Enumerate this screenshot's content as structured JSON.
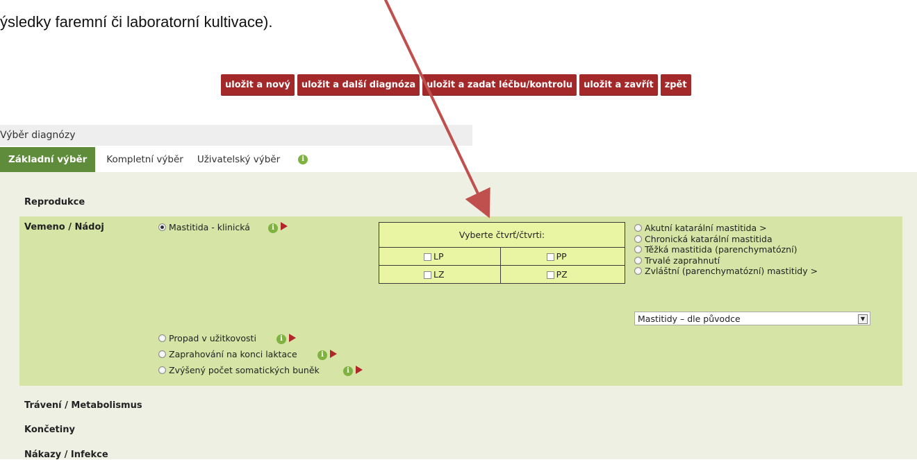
{
  "caption": "ýsledky faremní či laboratorní kultivace).",
  "toolbar": {
    "buttons": [
      "uložit a nový",
      "uložit a další diagnóza",
      "uložit a zadat léčbu/kontrolu",
      "uložit a zavřít",
      "zpět"
    ],
    "color": "#a3282a"
  },
  "section": {
    "title": "Výběr diagnózy"
  },
  "tabs": {
    "items": [
      "Základní výběr",
      "Kompletní výběr",
      "Uživatelský výběr"
    ],
    "active": "Základní výběr",
    "info_icon": "info-icon"
  },
  "categories": {
    "reprodukce": "Reprodukce",
    "vemeno": "Vemeno / Nádoj",
    "traveni": "Trávení / Metabolismus",
    "koncetiny": "Končetiny",
    "nakazy": "Nákazy / Infekce"
  },
  "diagnoses": {
    "mastitida": "Mastitida - klinická",
    "propad": "Propad v užitkovosti",
    "zaprahovani": "Zaprahování na konci laktace",
    "zvyseny": "Zvýšený počet somatických buněk",
    "selected": "Mastitida - klinická"
  },
  "quarters": {
    "header": "Vyberte čtvrť/čtvrti:",
    "lp": "LP",
    "pp": "PP",
    "lz": "LZ",
    "pz": "PZ"
  },
  "mastitis_types": [
    "Akutní katarální mastitida >",
    "Chronická katarální mastitida",
    "Těžká mastitida (parenchymatózní)",
    "Trvalé zaprahnutí",
    "Zvláštní (parenchymatózní) mastitidy >"
  ],
  "select": {
    "value": "Mastitidy – dle původce"
  },
  "colors": {
    "active_tab": "#5e8c3a",
    "panel": "#eef0e4",
    "highlight": "#d6e5a6",
    "arrow": "#c0504d"
  }
}
